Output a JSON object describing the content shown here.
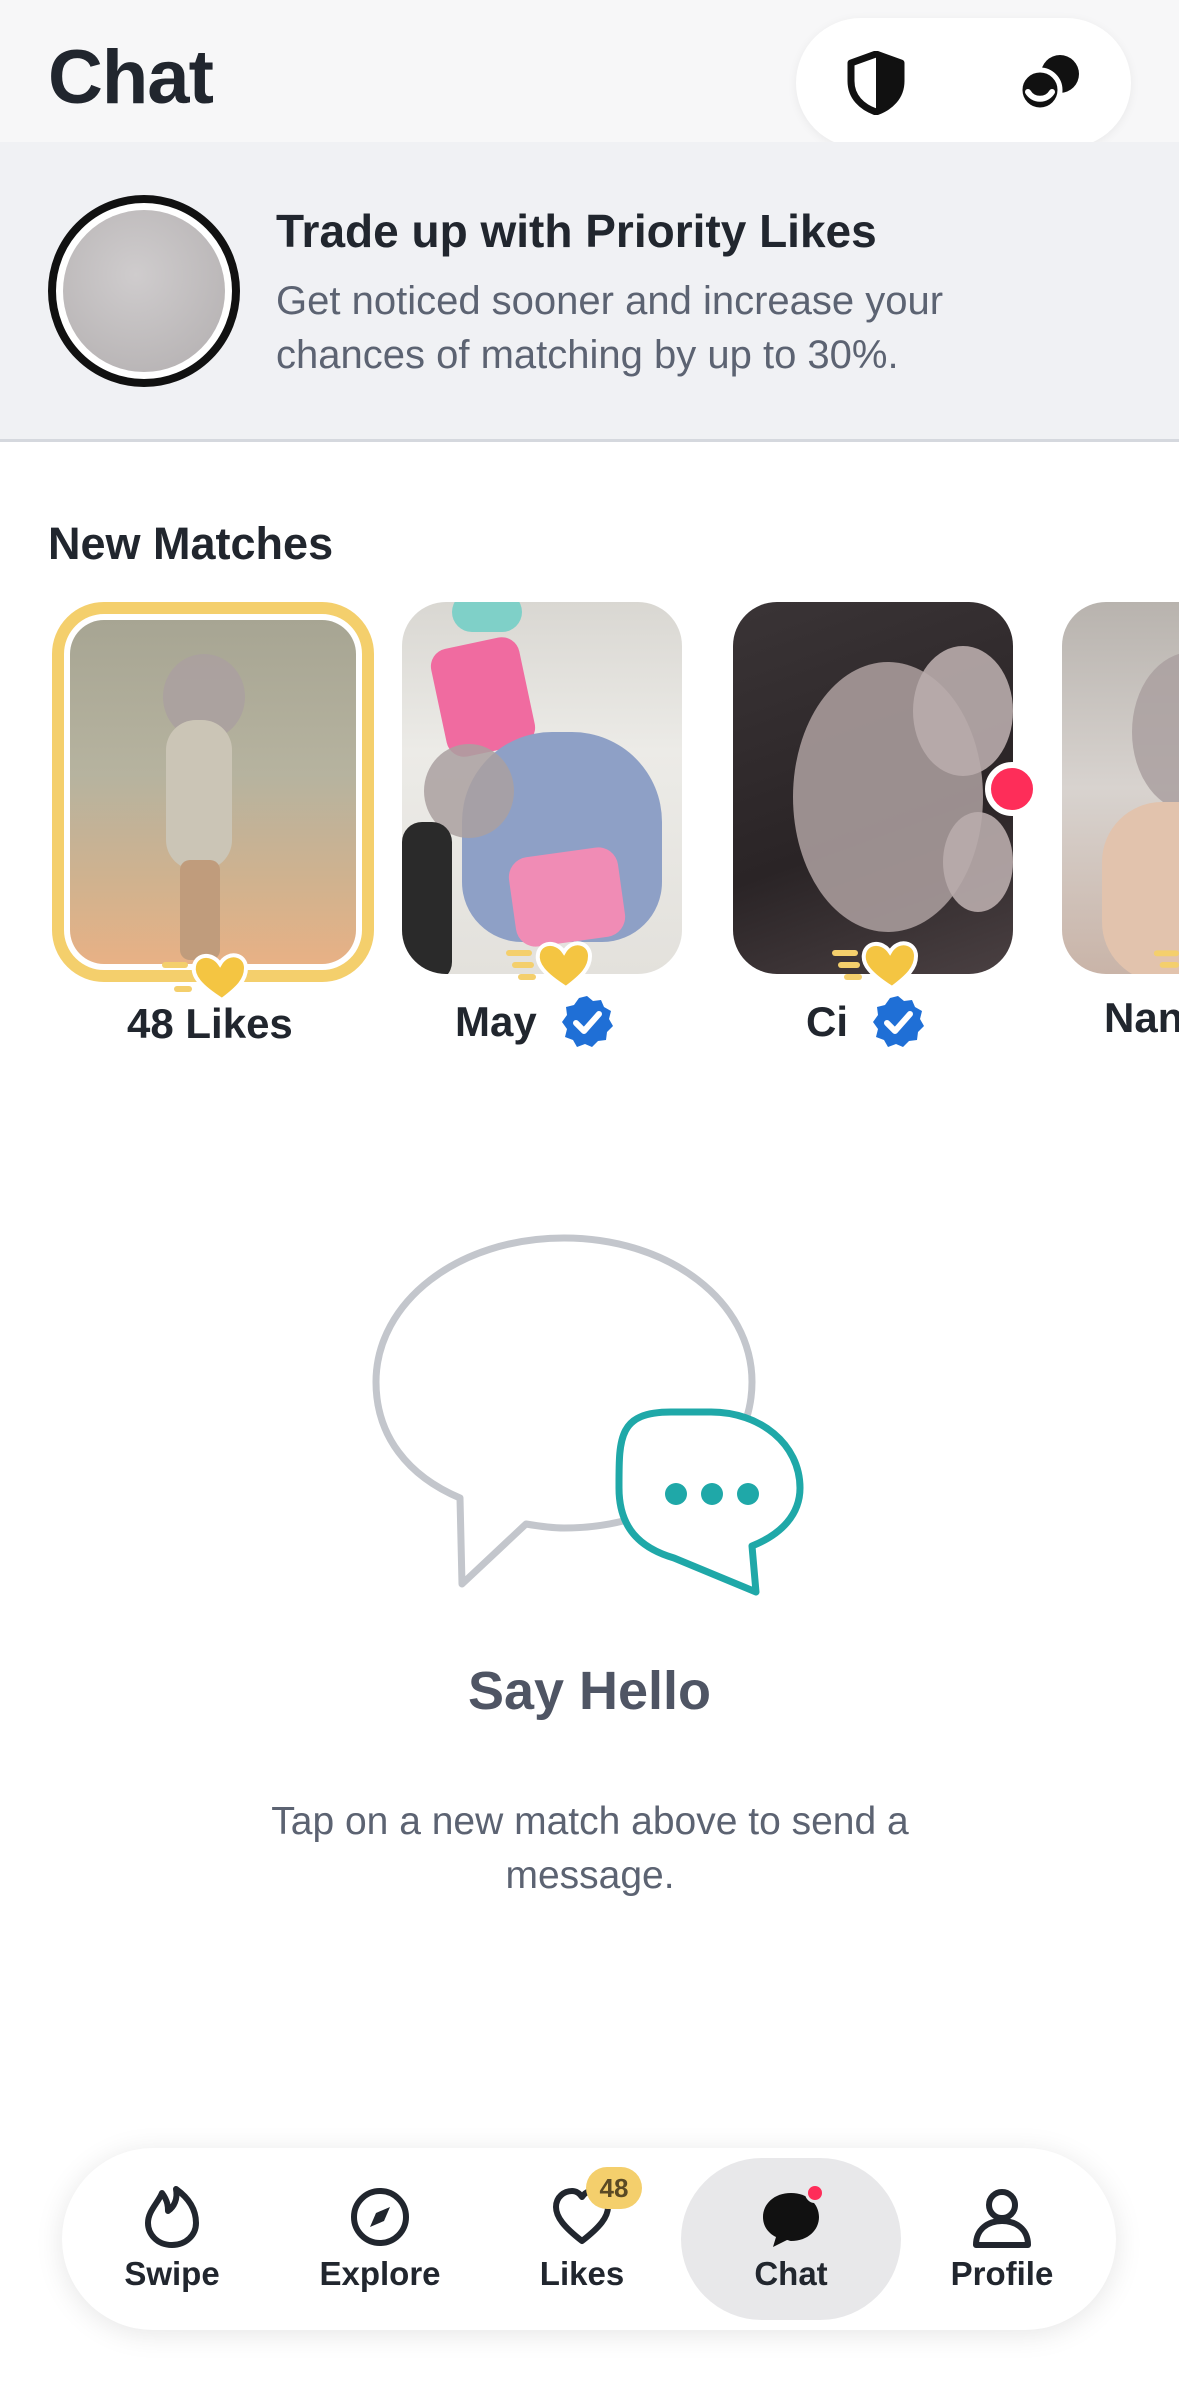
{
  "header": {
    "title": "Chat"
  },
  "promo": {
    "title": "Trade up with Priority Likes",
    "subtitle": "Get noticed sooner and increase your chances of matching by up to 30%."
  },
  "new_matches": {
    "title": "New Matches",
    "likes_label": "48 Likes",
    "matches": [
      {
        "name": "May",
        "verified": true
      },
      {
        "name": "Ci",
        "verified": true,
        "unread": true
      },
      {
        "name": "Nan"
      }
    ]
  },
  "empty_state": {
    "title": "Say Hello",
    "subtitle": "Tap on a new match above to send a message."
  },
  "nav": {
    "items": [
      {
        "label": "Swipe",
        "icon": "flame-icon"
      },
      {
        "label": "Explore",
        "icon": "compass-icon"
      },
      {
        "label": "Likes",
        "icon": "heart-icon",
        "badge": "48"
      },
      {
        "label": "Chat",
        "icon": "chat-bubble-icon",
        "active": true
      },
      {
        "label": "Profile",
        "icon": "person-icon"
      }
    ]
  },
  "colors": {
    "gold": "#f4cf6c",
    "teal": "#1fa8a8",
    "red_dot": "#fe2d59",
    "verified_blue": "#1f6fd6"
  }
}
